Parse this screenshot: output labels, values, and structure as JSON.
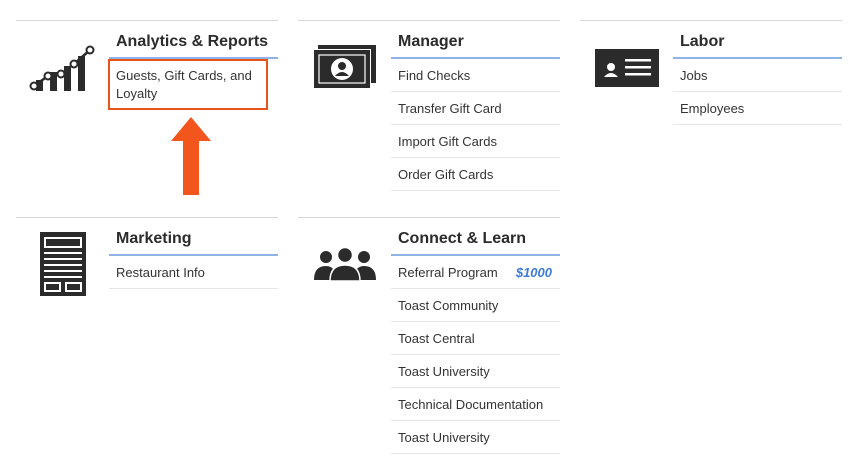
{
  "sections": {
    "analytics": {
      "title": "Analytics & Reports",
      "items": [
        {
          "label_line1": "Guests, Gift Cards, and",
          "label_line2": "Loyalty"
        }
      ]
    },
    "manager": {
      "title": "Manager",
      "items": [
        {
          "label": "Find Checks"
        },
        {
          "label": "Transfer Gift Card"
        },
        {
          "label": "Import Gift Cards"
        },
        {
          "label": "Order Gift Cards"
        }
      ]
    },
    "labor": {
      "title": "Labor",
      "items": [
        {
          "label": "Jobs"
        },
        {
          "label": "Employees"
        }
      ]
    },
    "marketing": {
      "title": "Marketing",
      "items": [
        {
          "label": "Restaurant Info"
        }
      ]
    },
    "connect": {
      "title": "Connect & Learn",
      "items": [
        {
          "label": "Referral Program",
          "badge": "$1000"
        },
        {
          "label": "Toast Community"
        },
        {
          "label": "Toast Central"
        },
        {
          "label": "Toast University"
        },
        {
          "label": "Technical Documentation"
        },
        {
          "label": "Toast University"
        }
      ]
    }
  },
  "colors": {
    "accent_rule": "#8fb3e6",
    "highlight": "#e8531c",
    "badge": "#3d7bd6",
    "icon": "#2b2b2b"
  },
  "icons": {
    "analytics": "analytics-chart-icon",
    "manager": "money-bill-person-icon",
    "labor": "id-card-icon",
    "marketing": "menu-document-icon",
    "connect": "people-group-icon"
  }
}
